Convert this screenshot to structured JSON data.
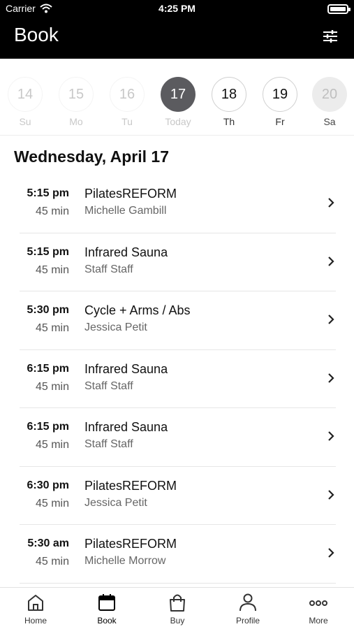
{
  "status_bar": {
    "carrier": "Carrier",
    "time": "4:25 PM"
  },
  "header": {
    "title": "Book",
    "filter_icon": "sliders-icon"
  },
  "days": [
    {
      "num": "14",
      "label": "Su",
      "state": "past"
    },
    {
      "num": "15",
      "label": "Mo",
      "state": "past"
    },
    {
      "num": "16",
      "label": "Tu",
      "state": "past"
    },
    {
      "num": "17",
      "label": "Today",
      "state": "today"
    },
    {
      "num": "18",
      "label": "Th",
      "state": "future"
    },
    {
      "num": "19",
      "label": "Fr",
      "state": "future"
    },
    {
      "num": "20",
      "label": "Sa",
      "state": "disabled"
    }
  ],
  "date_heading": "Wednesday, April 17",
  "classes": [
    {
      "time": "5:15 pm",
      "duration": "45 min",
      "name": "PilatesREFORM",
      "instructor": "Michelle Gambill"
    },
    {
      "time": "5:15 pm",
      "duration": "45 min",
      "name": "Infrared Sauna",
      "instructor": "Staff Staff"
    },
    {
      "time": "5:30 pm",
      "duration": "45 min",
      "name": "Cycle + Arms / Abs",
      "instructor": "Jessica Petit"
    },
    {
      "time": "6:15 pm",
      "duration": "45 min",
      "name": "Infrared Sauna",
      "instructor": "Staff Staff"
    },
    {
      "time": "6:15 pm",
      "duration": "45 min",
      "name": "Infrared Sauna",
      "instructor": "Staff Staff"
    },
    {
      "time": "6:30 pm",
      "duration": "45 min",
      "name": "PilatesREFORM",
      "instructor": "Jessica Petit"
    },
    {
      "time": "5:30 am",
      "duration": "45 min",
      "name": "PilatesREFORM",
      "instructor": "Michelle Morrow"
    }
  ],
  "tabs": [
    {
      "label": "Home",
      "icon": "home-icon"
    },
    {
      "label": "Book",
      "icon": "calendar-icon",
      "active": true
    },
    {
      "label": "Buy",
      "icon": "bag-icon"
    },
    {
      "label": "Profile",
      "icon": "person-icon"
    },
    {
      "label": "More",
      "icon": "more-icon"
    }
  ]
}
